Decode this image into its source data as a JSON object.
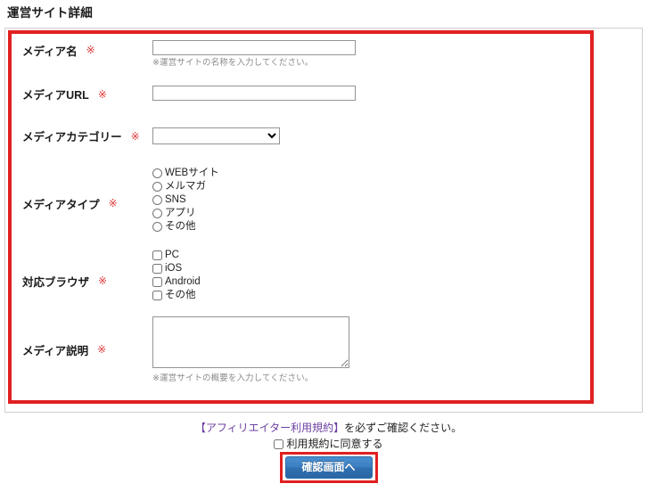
{
  "page": {
    "title": "運営サイト詳細"
  },
  "form": {
    "rows": [
      {
        "label": "メディア名",
        "required_mark": "※",
        "control": "text",
        "value": "",
        "hint": "※運営サイトの名称を入力してください。"
      },
      {
        "label": "メディアURL",
        "required_mark": "※",
        "control": "text",
        "value": "",
        "hint": ""
      },
      {
        "label": "メディアカテゴリー",
        "required_mark": "※",
        "control": "select",
        "selected": "",
        "options": [
          ""
        ],
        "hint": ""
      },
      {
        "label": "メディアタイプ",
        "required_mark": "※",
        "control": "radio",
        "options": [
          {
            "label": "WEBサイト",
            "checked": false
          },
          {
            "label": "メルマガ",
            "checked": false
          },
          {
            "label": "SNS",
            "checked": false
          },
          {
            "label": "アプリ",
            "checked": false
          },
          {
            "label": "その他",
            "checked": false
          }
        ],
        "hint": ""
      },
      {
        "label": "対応ブラウザ",
        "required_mark": "※",
        "control": "checkbox",
        "options": [
          {
            "label": "PC",
            "checked": false
          },
          {
            "label": "iOS",
            "checked": false
          },
          {
            "label": "Android",
            "checked": false
          },
          {
            "label": "その他",
            "checked": false
          }
        ],
        "hint": ""
      },
      {
        "label": "メディア説明",
        "required_mark": "※",
        "control": "textarea",
        "value": "",
        "hint": "※運営サイトの概要を入力してください。"
      }
    ]
  },
  "footer": {
    "terms_link_text": "【アフィリエイター利用規約】",
    "terms_suffix_text": "を必ずご確認ください。",
    "agree_label": "利用規約に同意する",
    "agree_checked": false,
    "submit_label": "確認画面へ"
  },
  "colors": {
    "highlight_red": "#e02020",
    "required_red": "#e03a3a",
    "link_purple": "#6b3fa0",
    "button_blue": "#3b7ec0",
    "panel_border": "#cfcfcf",
    "input_border": "#949494",
    "hint_gray": "#8a8a8a"
  }
}
